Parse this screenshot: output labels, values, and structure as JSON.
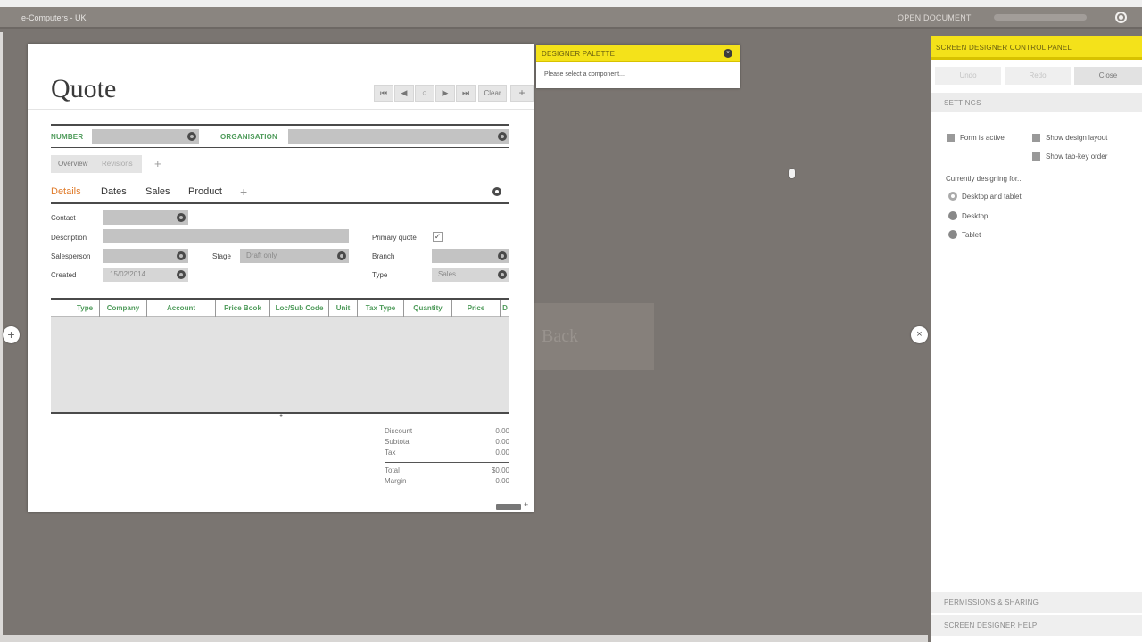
{
  "topbar": {
    "app_title": "e-Computers - UK",
    "open_document": "OPEN DOCUMENT",
    "user_icon": "user-circle-icon"
  },
  "side_toggles": {
    "left": "+",
    "right": "×"
  },
  "background_card": {
    "title": "Back"
  },
  "form": {
    "title": "Quote",
    "nav_buttons": [
      "⏮",
      "◀",
      "○",
      "▶",
      "⏭"
    ],
    "clear_label": "Clear",
    "add_label": "+",
    "number_label": "NUMBER",
    "organisation_label": "ORGANISATION",
    "subtabs": [
      "Overview",
      "Revisions"
    ],
    "subtab_add": "+",
    "tabs": [
      "Details",
      "Dates",
      "Sales",
      "Product"
    ],
    "active_tab": "Details",
    "tab_add": "+",
    "fields": {
      "contact": "Contact",
      "description": "Description",
      "primary_quote": "Primary quote",
      "salesperson": "Salesperson",
      "stage": "Stage",
      "stage_value": "Draft only",
      "branch": "Branch",
      "created": "Created",
      "created_value": "15/02/2014",
      "type": "Type",
      "type_value": "Sales"
    },
    "primary_quote_checked": true,
    "grid_columns": [
      "Type",
      "Company",
      "Account",
      "Price Book",
      "Loc/Sub Code",
      "Unit",
      "Tax Type",
      "Quantity",
      "Price",
      "D"
    ],
    "totals": [
      {
        "label": "Discount",
        "value": "0.00"
      },
      {
        "label": "Subtotal",
        "value": "0.00"
      },
      {
        "label": "Tax",
        "value": "0.00"
      },
      {
        "label": "Total",
        "value": "$0.00"
      },
      {
        "label": "Margin",
        "value": "0.00"
      }
    ]
  },
  "palette": {
    "title": "DESIGNER PALETTE",
    "message": "Please select a component..."
  },
  "control_panel": {
    "title": "SCREEN DESIGNER CONTROL PANEL",
    "undo_label": "Undo",
    "redo_label": "Redo",
    "close_label": "Close",
    "settings_label": "SETTINGS",
    "form_active_label": "Form is active",
    "show_design_layout_label": "Show design layout",
    "show_tab_key_order_label": "Show tab-key order",
    "designing_for_label": "Currently designing for...",
    "device_options": [
      "Desktop and tablet",
      "Desktop",
      "Tablet"
    ],
    "selected_device": "Desktop and tablet",
    "permissions_label": "PERMISSIONS & SHARING",
    "help_label": "SCREEN DESIGNER HELP"
  }
}
